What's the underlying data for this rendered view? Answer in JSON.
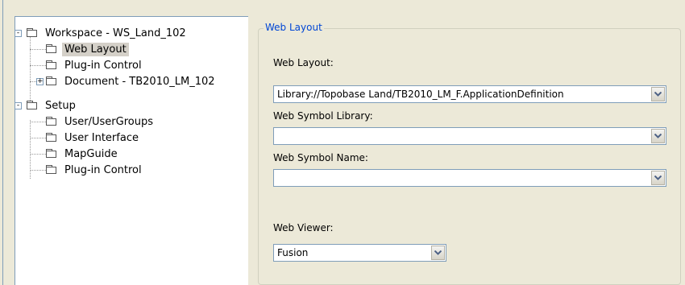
{
  "tree": {
    "items": [
      {
        "label": "Workspace - WS_Land_102",
        "icon": "folder-icon",
        "expander": "-"
      },
      {
        "label": "Web Layout",
        "icon": "folder-icon",
        "selected": true
      },
      {
        "label": "Plug-in Control",
        "icon": "folder-icon"
      },
      {
        "label": "Document - TB2010_LM_102",
        "icon": "folder-icon",
        "expander": "+"
      },
      {
        "label": "Setup",
        "icon": "folder-icon",
        "expander": "-"
      },
      {
        "label": "User/UserGroups",
        "icon": "folder-icon"
      },
      {
        "label": "User Interface",
        "icon": "folder-icon"
      },
      {
        "label": "MapGuide",
        "icon": "folder-icon"
      },
      {
        "label": "Plug-in Control",
        "icon": "folder-icon"
      }
    ]
  },
  "panel": {
    "group_title": "Web Layout",
    "web_layout_label": "Web Layout:",
    "web_layout_value": "Library://Topobase Land/TB2010_LM_F.ApplicationDefinition",
    "web_symbol_library_label": "Web Symbol Library:",
    "web_symbol_library_value": "",
    "web_symbol_name_label": "Web Symbol Name:",
    "web_symbol_name_value": "",
    "web_viewer_label": "Web Viewer:",
    "web_viewer_value": "Fusion"
  },
  "colors": {
    "accent_text": "#0046d5",
    "selection": "#d4d0c8",
    "window_bg": "#ece9d8"
  }
}
